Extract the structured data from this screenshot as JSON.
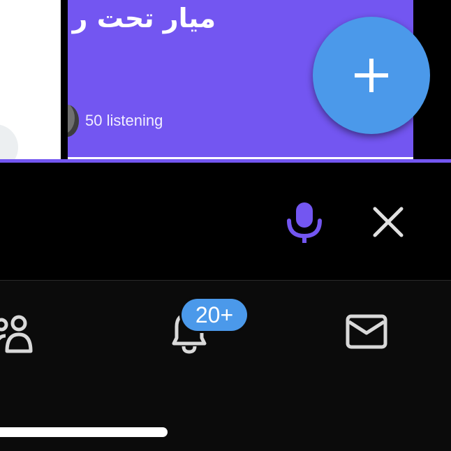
{
  "space_card": {
    "title": "ميار تحت ر",
    "listener_count": "50 listening"
  },
  "audio_bar": {
    "mic_icon": "microphone-icon",
    "close_icon": "close-icon"
  },
  "fab": {
    "icon": "plus-icon"
  },
  "bottom_nav": {
    "items": [
      {
        "icon": "communities-icon"
      },
      {
        "icon": "bell-icon",
        "badge": "20+"
      },
      {
        "icon": "mail-icon"
      }
    ]
  },
  "colors": {
    "space_purple": "#7356f1",
    "accent_blue": "#4b99ea",
    "icon_gray": "#d9d9d9",
    "background": "#000000"
  }
}
